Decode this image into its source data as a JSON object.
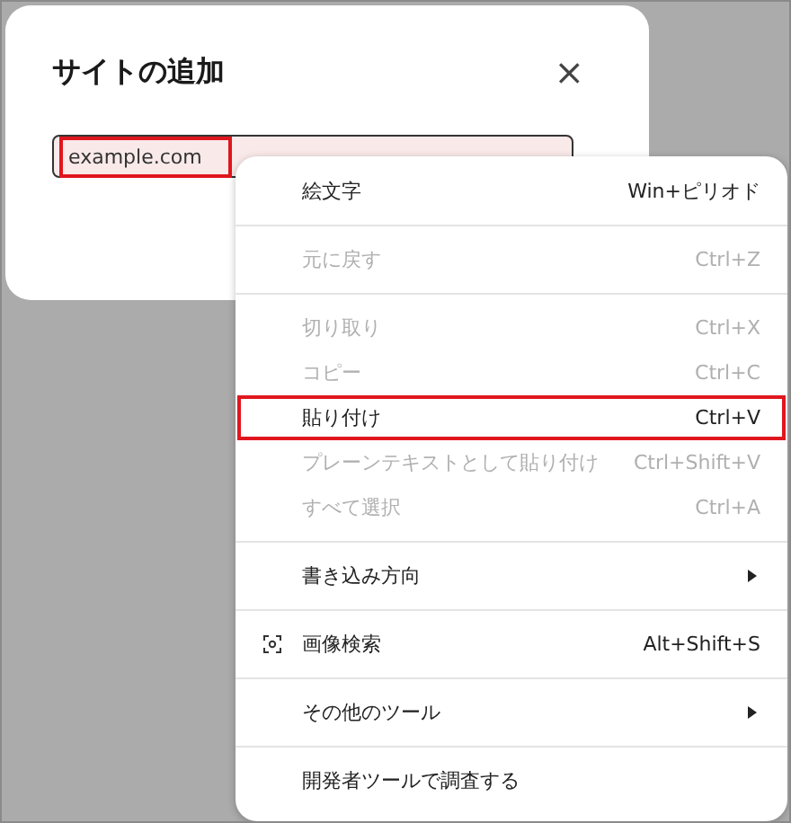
{
  "dialog": {
    "title": "サイトの追加",
    "close": "×",
    "input": {
      "value": "example.com",
      "highlighted": true
    }
  },
  "context_menu": {
    "items": [
      {
        "kind": "item",
        "label": "絵文字",
        "shortcut": "Win+ピリオド",
        "disabled": false,
        "highlighted": false
      },
      {
        "kind": "separator"
      },
      {
        "kind": "item",
        "label": "元に戻す",
        "shortcut": "Ctrl+Z",
        "disabled": true,
        "highlighted": false
      },
      {
        "kind": "separator"
      },
      {
        "kind": "item",
        "label": "切り取り",
        "shortcut": "Ctrl+X",
        "disabled": true,
        "highlighted": false
      },
      {
        "kind": "item",
        "label": "コピー",
        "shortcut": "Ctrl+C",
        "disabled": true,
        "highlighted": false
      },
      {
        "kind": "item",
        "label": "貼り付け",
        "shortcut": "Ctrl+V",
        "disabled": false,
        "highlighted": true
      },
      {
        "kind": "item",
        "label": "プレーンテキストとして貼り付け",
        "shortcut": "Ctrl+Shift+V",
        "disabled": true,
        "highlighted": false
      },
      {
        "kind": "item",
        "label": "すべて選択",
        "shortcut": "Ctrl+A",
        "disabled": true,
        "highlighted": false
      },
      {
        "kind": "separator"
      },
      {
        "kind": "item",
        "label": "書き込み方向",
        "submenu": true,
        "disabled": false,
        "highlighted": false
      },
      {
        "kind": "separator"
      },
      {
        "kind": "item",
        "label": "画像検索",
        "shortcut": "Alt+Shift+S",
        "icon": true,
        "disabled": false,
        "highlighted": false
      },
      {
        "kind": "separator"
      },
      {
        "kind": "item",
        "label": "その他のツール",
        "submenu": true,
        "disabled": false,
        "highlighted": false
      },
      {
        "kind": "separator"
      },
      {
        "kind": "item",
        "label": "開発者ツールで調査する",
        "disabled": false,
        "highlighted": false
      }
    ]
  }
}
